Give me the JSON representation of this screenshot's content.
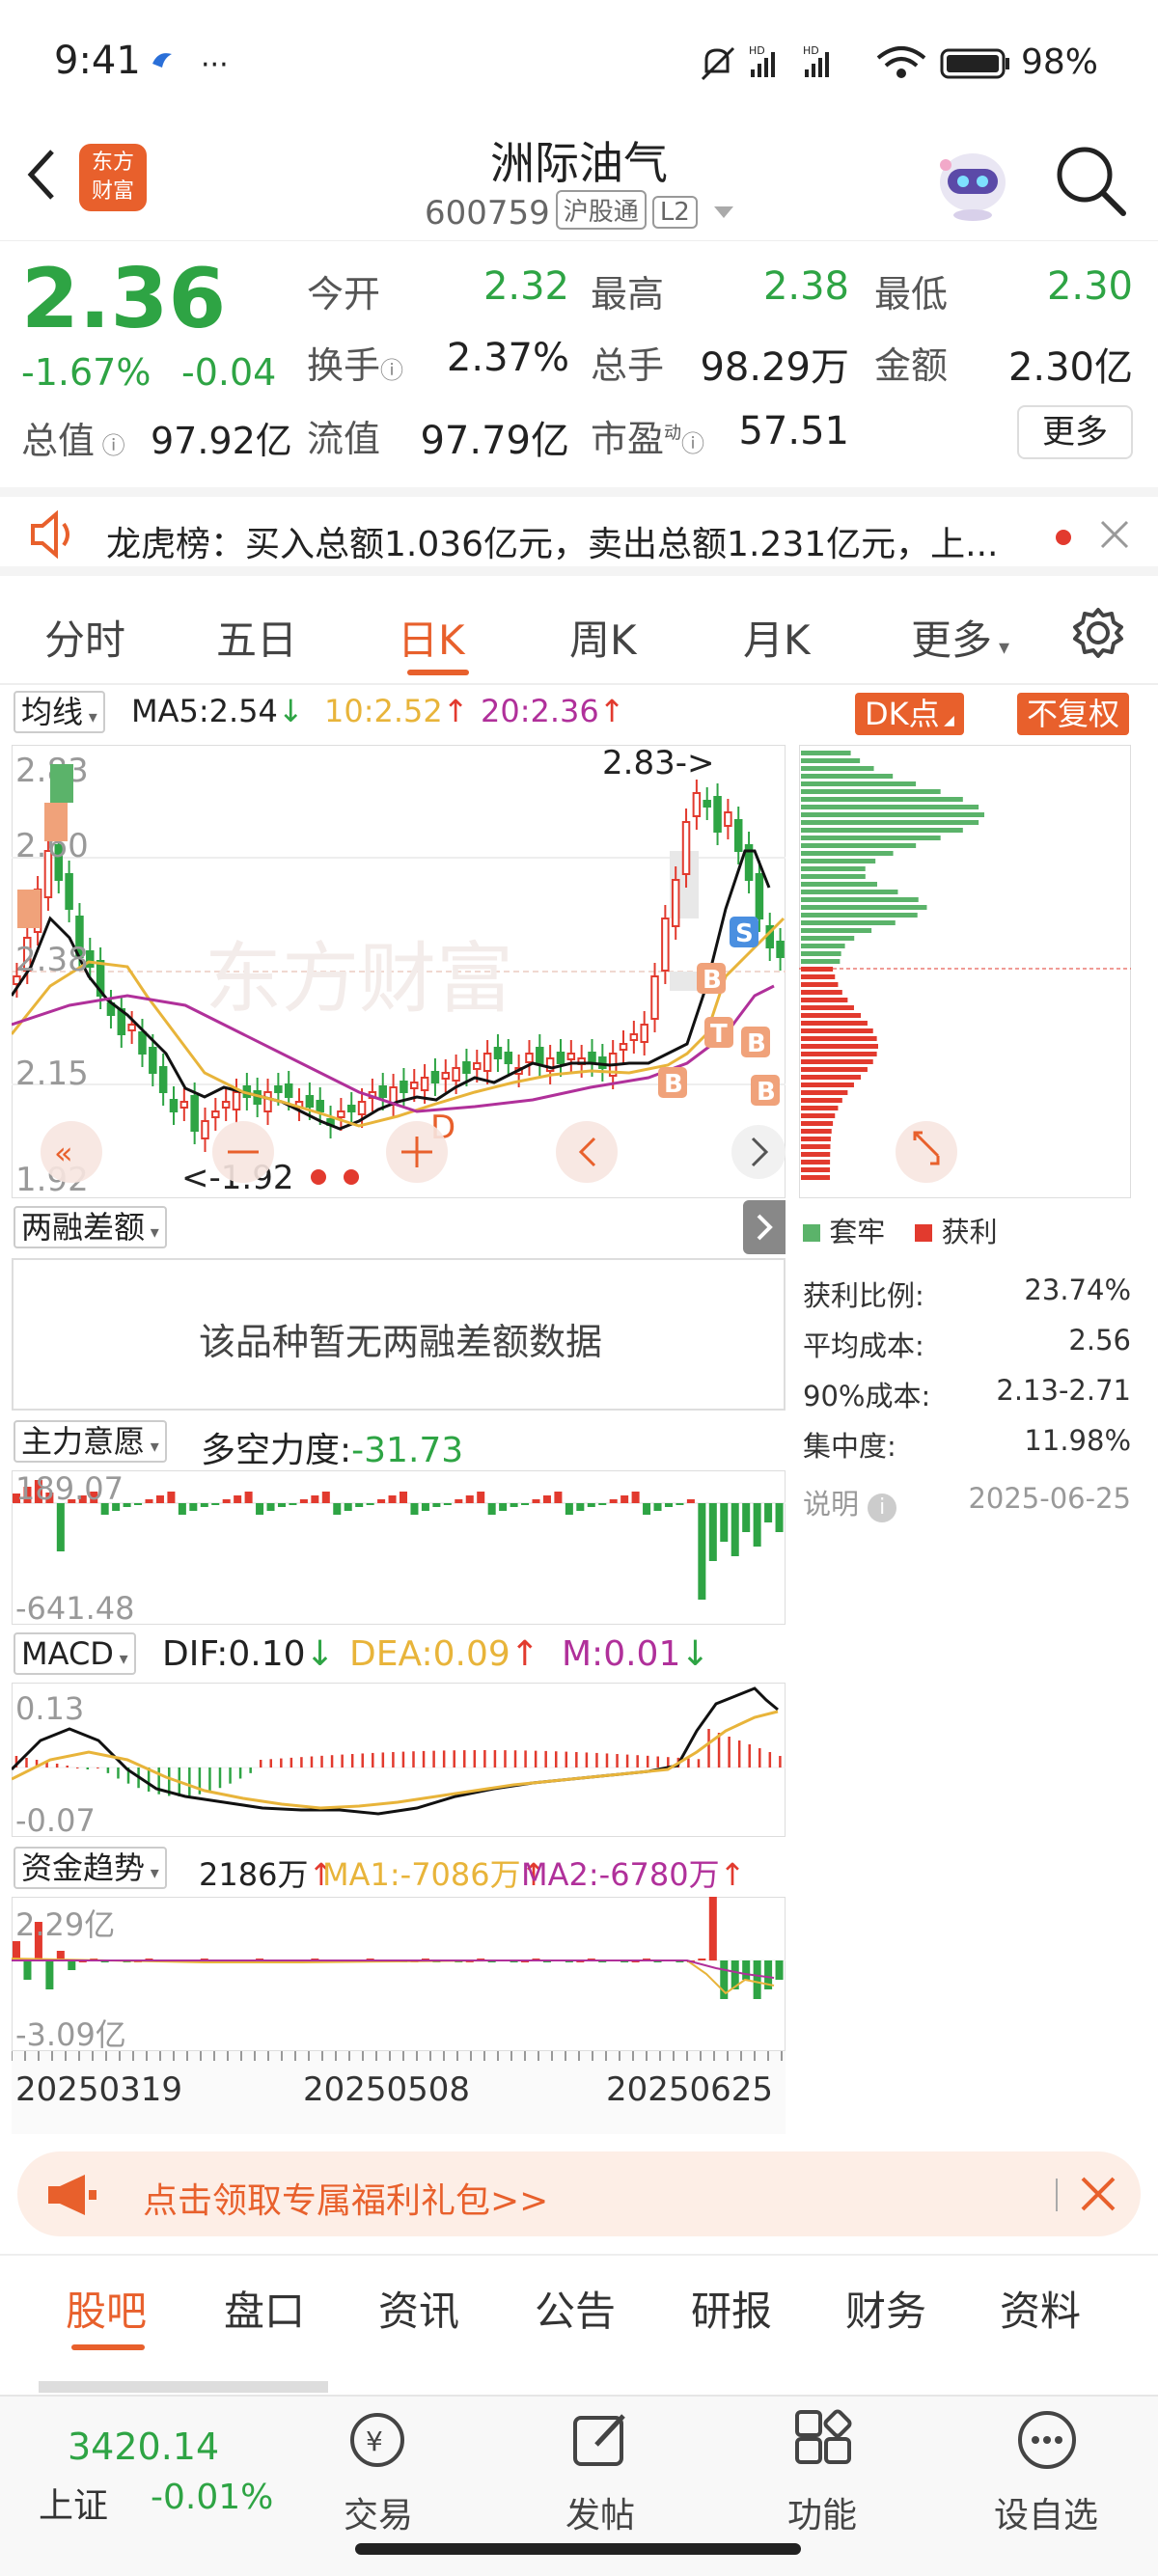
{
  "status": {
    "time": "9:41",
    "battery": "98%"
  },
  "header": {
    "title": "洲际油气",
    "code": "600759",
    "tag1": "沪股通",
    "tag2": "L2"
  },
  "quote": {
    "price": "2.36",
    "change_pct": "-1.67%",
    "change": "-0.04",
    "open_label": "今开",
    "open": "2.32",
    "high_label": "最高",
    "high": "2.38",
    "low_label": "最低",
    "low": "2.30",
    "turnover_label": "换手",
    "turnover": "2.37%",
    "volume_label": "总手",
    "volume": "98.29万",
    "amount_label": "金额",
    "amount": "2.30亿",
    "mktcap_label": "总值",
    "mktcap": "97.92亿",
    "float_label": "流值",
    "float": "97.79亿",
    "pe_label": "市盈",
    "pe_sup": "动",
    "pe": "57.51",
    "more": "更多"
  },
  "notice": {
    "text": "龙虎榜：买入总额1.036亿元，卖出总额1.231亿元，上..."
  },
  "tabs": [
    "分时",
    "五日",
    "日K",
    "周K",
    "月K",
    "更多"
  ],
  "active_tab": "日K",
  "ma": {
    "selector": "均线",
    "ma5": "MA5:2.54",
    "ma10": "10:2.52",
    "ma20": "20:2.36",
    "dk": "DK点",
    "fq": "不复权"
  },
  "kline": {
    "y_labels": [
      "2.83",
      "2.60",
      "2.38",
      "2.15",
      "1.92"
    ],
    "high_note": "2.83->",
    "low_note": "<-1.92",
    "watermark": "东方财富",
    "bs_marks": [
      "S",
      "T",
      "B",
      "B",
      "B",
      "B"
    ],
    "d_mark": "D"
  },
  "margin": {
    "selector": "两融差额",
    "empty": "该品种暂无两融差额数据"
  },
  "main_force": {
    "selector": "主力意愿",
    "label": "多空力度:",
    "value": "-31.73",
    "top": "189.07",
    "bottom": "-641.48"
  },
  "macd": {
    "selector": "MACD",
    "dif": "DIF:0.10",
    "dea": "DEA:0.09",
    "m": "M:0.01",
    "top": "0.13",
    "bottom": "-0.07"
  },
  "fund": {
    "selector": "资金趋势",
    "val": "2186万",
    "ma1": "MA1:-7086万",
    "ma2": "MA2:-6780万",
    "top": "2.29亿",
    "bottom": "-3.09亿"
  },
  "dates": [
    "20250319",
    "20250508",
    "20250625"
  ],
  "chip": {
    "legend_trapped": "套牢",
    "legend_profit": "获利",
    "rows": [
      {
        "label": "获利比例:",
        "value": "23.74%"
      },
      {
        "label": "平均成本:",
        "value": "2.56"
      },
      {
        "label": "90%成本:",
        "value": "2.13-2.71"
      },
      {
        "label": "集中度:",
        "value": "11.98%"
      }
    ],
    "note": "说明",
    "date": "2025-06-25"
  },
  "promo": "点击领取专属福利礼包>>",
  "bottom_tabs": [
    "股吧",
    "盘口",
    "资讯",
    "公告",
    "研报",
    "财务",
    "资料"
  ],
  "ticker": {
    "value": "3420.14",
    "name": "上证",
    "change": "-0.01%"
  },
  "nav": [
    "交易",
    "发帖",
    "功能",
    "设自选"
  ],
  "colors": {
    "up": "#e23a2e",
    "down": "#2ea444",
    "accent": "#e8602c",
    "ma10": "#e8b43a",
    "ma20": "#b0309a"
  }
}
